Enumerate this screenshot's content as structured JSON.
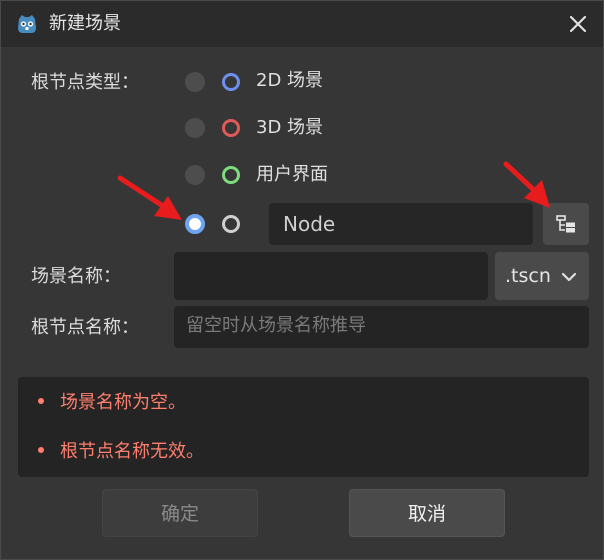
{
  "window": {
    "title": "新建场景"
  },
  "form": {
    "root_type_label": "根节点类型：",
    "options": [
      {
        "label": "2D 场景",
        "icon": "node2d-icon",
        "color": "#6e8ef0",
        "selected": false
      },
      {
        "label": "3D 场景",
        "icon": "node3d-icon",
        "color": "#e05a5a",
        "selected": false
      },
      {
        "label": "用户界面",
        "icon": "control-icon",
        "color": "#7ddc7d",
        "selected": false
      },
      {
        "label": "",
        "icon": "node-icon",
        "color": "#cfcfcf",
        "selected": true
      }
    ],
    "custom_node_value": "Node",
    "scene_name_label": "场景名称：",
    "scene_name_value": "",
    "extension_value": ".tscn",
    "root_name_label": "根节点名称：",
    "root_name_placeholder": "留空时从场景名称推导"
  },
  "errors": [
    "场景名称为空。",
    "根节点名称无效。"
  ],
  "buttons": {
    "ok": "确定",
    "cancel": "取消"
  },
  "colors": {
    "error": "#ff7e6e",
    "accent": "#6ea4f2",
    "annotation_arrow": "#e81c1c"
  }
}
